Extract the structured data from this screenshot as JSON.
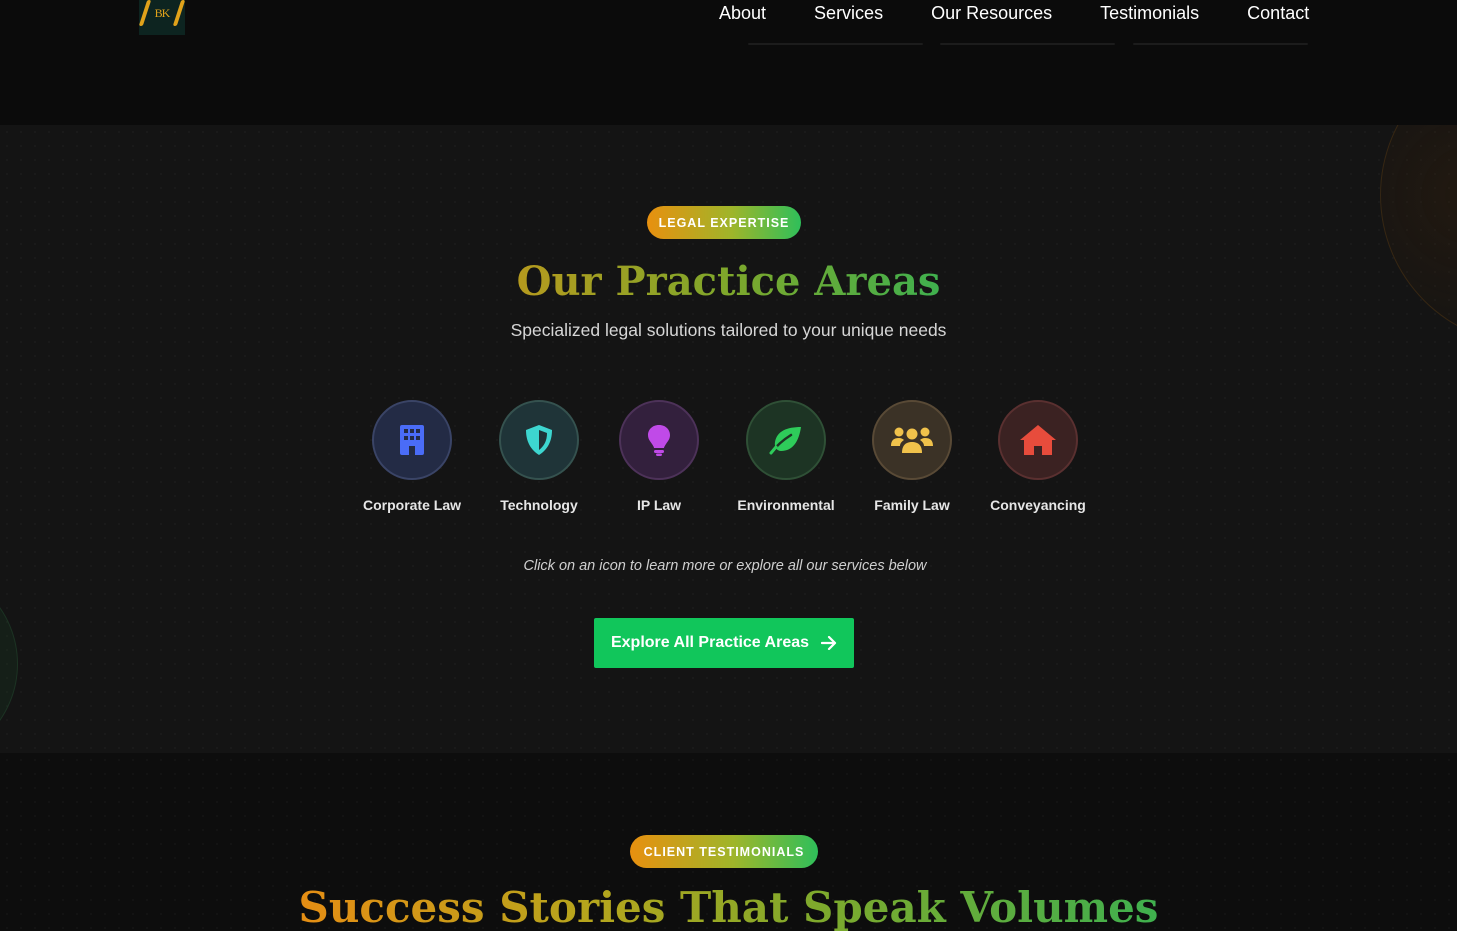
{
  "header": {
    "logo_text": "BK",
    "nav": [
      "About",
      "Services",
      "Our Resources",
      "Testimonials",
      "Contact"
    ]
  },
  "practice": {
    "badge": "LEGAL EXPERTISE",
    "title": "Our Practice Areas",
    "subtitle": "Specialized legal solutions tailored to your unique needs",
    "areas": [
      {
        "label": "Corporate Law",
        "icon": "building-icon",
        "color": "#4a6cf7",
        "bg": "#232b45"
      },
      {
        "label": "Technology",
        "icon": "shield-icon",
        "color": "#3dd6d0",
        "bg": "#1f3438"
      },
      {
        "label": "IP Law",
        "icon": "lightbulb-icon",
        "color": "#c04ae8",
        "bg": "#33203d"
      },
      {
        "label": "Environmental",
        "icon": "leaf-icon",
        "color": "#2ecc5a",
        "bg": "#1d3424"
      },
      {
        "label": "Family Law",
        "icon": "users-icon",
        "color": "#f0c24b",
        "bg": "#3b3226"
      },
      {
        "label": "Conveyancing",
        "icon": "home-icon",
        "color": "#e74c3c",
        "bg": "#3b2222"
      }
    ],
    "hint": "Click on an icon to learn more or explore all our services below",
    "cta_label": "Explore All Practice Areas"
  },
  "testimonials": {
    "badge": "CLIENT TESTIMONIALS",
    "title": "Success Stories That Speak Volumes"
  }
}
